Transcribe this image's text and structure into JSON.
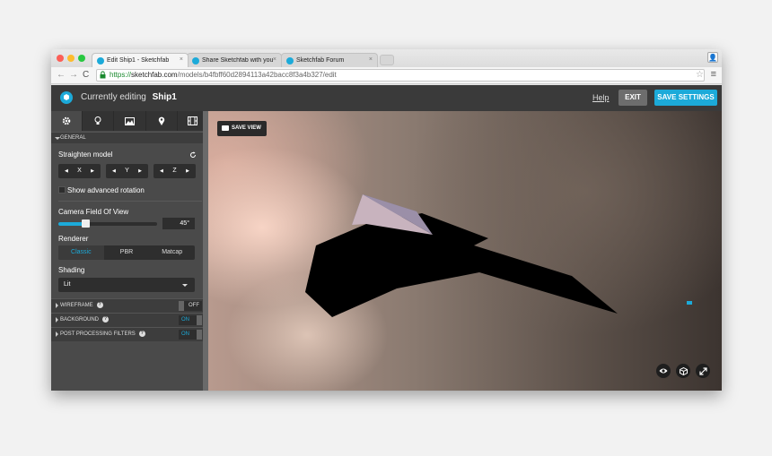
{
  "browser": {
    "tabs": [
      {
        "title": "Edit Ship1 - Sketchfab",
        "active": true
      },
      {
        "title": "Share Sketchfab with you",
        "active": false
      },
      {
        "title": "Sketchfab Forum",
        "active": false
      }
    ],
    "url": {
      "scheme": "https://",
      "host": "sketchfab.com",
      "path": "/models/b4fbff60d2894113a42bacc8f3a4b327/edit"
    }
  },
  "header": {
    "editing_label": "Currently editing",
    "model_name": "Ship1",
    "help_label": "Help",
    "exit_label": "EXIT",
    "save_settings_label": "SAVE SETTINGS",
    "accent": "#1caad9"
  },
  "sidebar": {
    "tab_icons": [
      "gear-icon",
      "lightbulb-icon",
      "image-icon",
      "pin-icon",
      "film-icon"
    ],
    "general": {
      "title": "GENERAL",
      "straighten_label": "Straighten model",
      "axes": [
        "X",
        "Y",
        "Z"
      ],
      "advanced_rotation_label": "Show advanced rotation",
      "fov_label": "Camera Field Of View",
      "fov_value": "45°",
      "fov_fraction": 0.27,
      "renderer_label": "Renderer",
      "renderer_options": [
        "Classic",
        "PBR",
        "Matcap"
      ],
      "renderer_selected": "Classic",
      "shading_label": "Shading",
      "shading_value": "Lit"
    },
    "panels": [
      {
        "title": "WIREFRAME",
        "state": "OFF"
      },
      {
        "title": "BACKGROUND",
        "state": "ON"
      },
      {
        "title": "POST PROCESSING FILTERS",
        "state": "ON"
      }
    ]
  },
  "viewport": {
    "save_view_label": "SAVE VIEW",
    "controls": [
      "eye-icon",
      "cube-icon",
      "fullscreen-icon"
    ]
  }
}
